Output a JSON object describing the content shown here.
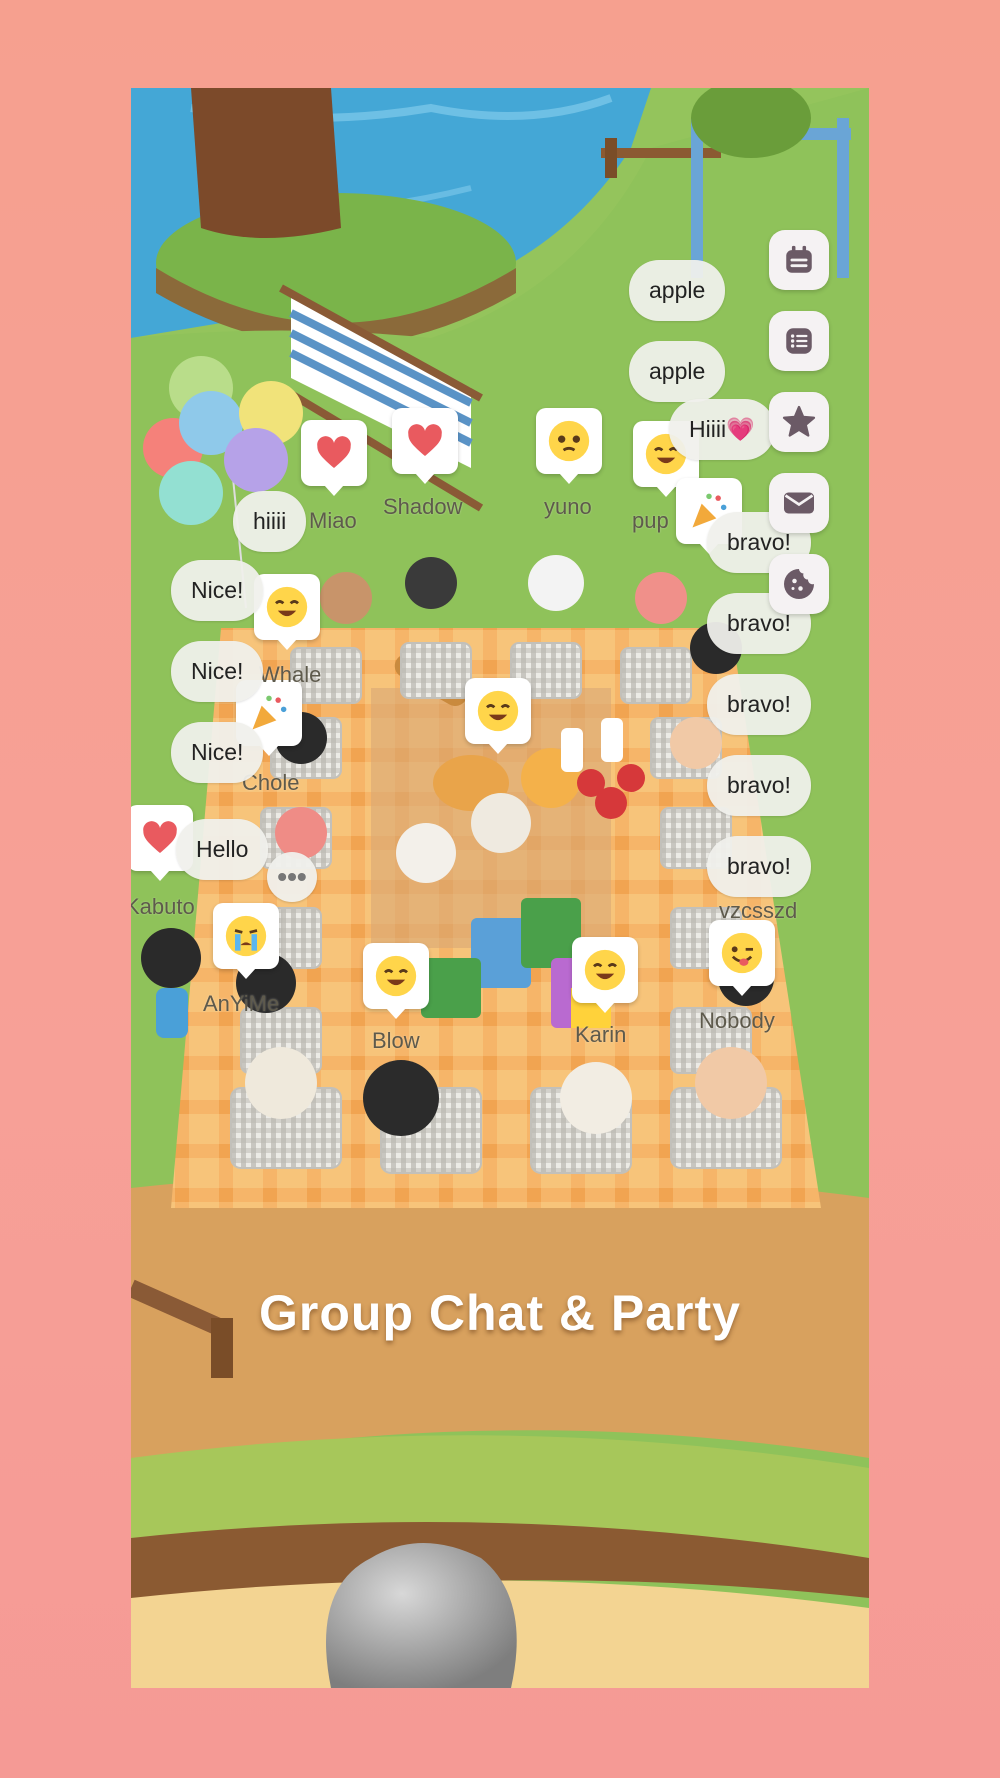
{
  "title": "Group Chat & Party",
  "players": {
    "miao": "Miao",
    "shadow": "Shadow",
    "yuno": "yuno",
    "pup": "pup",
    "whale": "Whale",
    "chole": "Chole",
    "kabuto": "Kabuto",
    "anyime": "AnYiMe",
    "blow": "Blow",
    "karin": "Karin",
    "nobody": "Nobody",
    "vzcsszd": "vzcsszd"
  },
  "messages": {
    "apple1": "apple",
    "apple2": "apple",
    "hiiii_heart": "Hiiii💗",
    "hiiii": "hiiii",
    "nice1": "Nice!",
    "nice2": "Nice!",
    "nice3": "Nice!",
    "hello": "Hello",
    "bravo1": "bravo!",
    "bravo2": "bravo!",
    "bravo3": "bravo!",
    "bravo4": "bravo!",
    "bravo5": "bravo!",
    "more": "•••"
  },
  "side_menu": [
    "calendar-icon",
    "list-icon",
    "star-icon",
    "mail-icon",
    "cookie-icon"
  ],
  "colors": {
    "background": "#f6a08f",
    "heart": "#e95a5f",
    "emoji": "#ffd54a",
    "side_icon": "#6b5a66"
  }
}
